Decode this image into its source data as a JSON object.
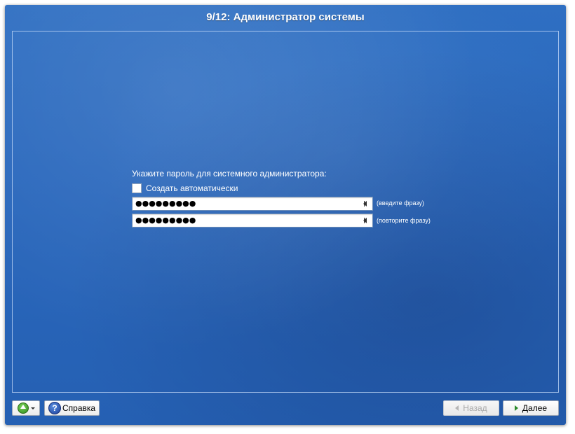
{
  "window": {
    "title": "9/12: Администратор системы"
  },
  "form": {
    "prompt": "Укажите пароль для системного администратора:",
    "auto_generate_label": "Создать автоматически",
    "auto_generate_checked": false,
    "password_field": {
      "value_masked": "●●●●●●●●●",
      "hint": "(введите фразу)"
    },
    "confirm_field": {
      "value_masked": "●●●●●●●●●",
      "hint": "(повторите фразу)"
    }
  },
  "footer": {
    "up_button_icon": "go-up-icon",
    "help_label": "Справка",
    "help_icon": "help-icon",
    "back_label": "Назад",
    "back_enabled": false,
    "next_label": "Далее"
  },
  "colors": {
    "background": "#2a68bd",
    "text": "#ffffff",
    "next_arrow": "#2a8a2a"
  }
}
